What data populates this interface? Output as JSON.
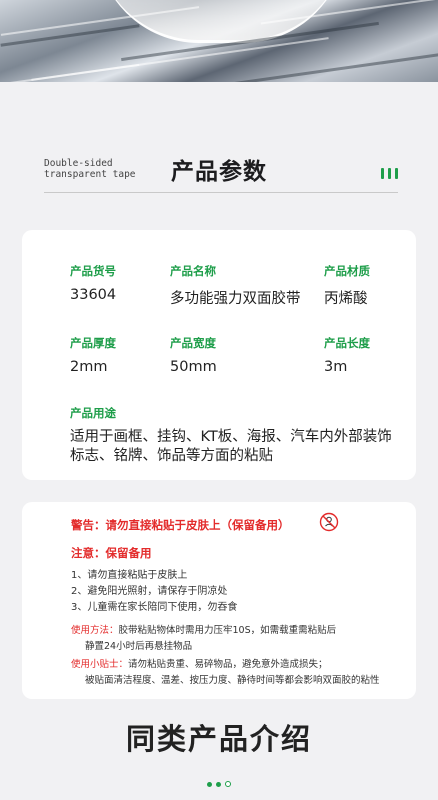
{
  "section": {
    "en_line1": "Double-sided",
    "en_line2": "transparent tape",
    "title": "产品参数"
  },
  "params": {
    "item_no_label": "产品货号",
    "item_no": "33604",
    "name_label": "产品名称",
    "name": "多功能强力双面胶带",
    "material_label": "产品材质",
    "material": "丙烯酸",
    "thickness_label": "产品厚度",
    "thickness": "2mm",
    "width_label": "产品宽度",
    "width": "50mm",
    "length_label": "产品长度",
    "length": "3m",
    "use_label": "产品用途",
    "use_line1": "适用于画框、挂钩、KT板、海报、汽车内外部装饰",
    "use_line2": "标志、铭牌、饰品等方面的粘贴"
  },
  "notice": {
    "warning": "警告：请勿直接粘贴于皮肤上（保留备用）",
    "caution": "注意：保留备用",
    "items": [
      "1、请勿直接粘贴于皮肤上",
      "2、避免阳光照射，请保存于阴凉处",
      "3、儿童需在家长陪同下使用，勿吞食"
    ],
    "method_label": "使用方法：",
    "method_line1": "胶带粘贴物体时需用力压牢10S，如需载重需粘贴后",
    "method_line2": "静置24小时后再悬挂物品",
    "tip_label": "使用小贴士：",
    "tip_line1": "请勿粘贴贵重、易碎物品，避免意外造成损失；",
    "tip_line2": "被贴面清洁程度、温差、按压力度、静待时间等都会影响双面胶的粘性"
  },
  "next_section_title": "同类产品介绍",
  "colors": {
    "accent": "#1e9e4a",
    "warning": "#e32b2b",
    "background": "#f1f1f3"
  },
  "icons": [
    "no-baby-icon",
    "section-bars-icon",
    "pagination-dots"
  ]
}
